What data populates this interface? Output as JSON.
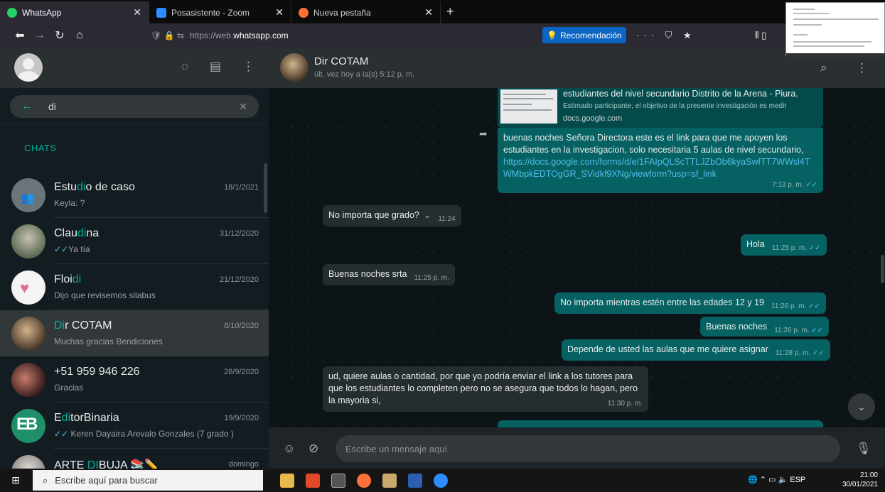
{
  "browser": {
    "tabs": [
      {
        "title": "WhatsApp",
        "active": true,
        "color": "#25d366"
      },
      {
        "title": "Posasistente - Zoom",
        "active": false,
        "color": "#2d8cff"
      },
      {
        "title": "Nueva pestaña",
        "active": false,
        "color": "#ff7139"
      }
    ],
    "url_prefix": "https://web.",
    "url_host": "whatsapp.com",
    "recommendation_label": "Recomendación"
  },
  "sidebar": {
    "search_value": "di",
    "chats_label": "CHATS",
    "chats": [
      {
        "pre": "Estu",
        "hl": "di",
        "post": "o de caso",
        "date": "18/1/2021",
        "preview": "Keyla: ?",
        "tick": false,
        "selected": false,
        "avatar": "group"
      },
      {
        "pre": "Clau",
        "hl": "di",
        "post": "na",
        "date": "31/12/2020",
        "preview": "Ya tía",
        "tick": true,
        "selected": false,
        "avatar": "photo1"
      },
      {
        "pre": "Floi",
        "hl": "di",
        "post": "",
        "date": "21/12/2020",
        "preview": "Dijo que revisemos silabus",
        "tick": false,
        "selected": false,
        "avatar": "photo2"
      },
      {
        "pre": "",
        "hl": "Di",
        "post": "r COTAM",
        "date": "8/10/2020",
        "preview": "Muchas gracias Bendiciones",
        "tick": false,
        "selected": true,
        "avatar": "photo3"
      },
      {
        "pre": "+51 959 946 226",
        "hl": "",
        "post": "",
        "date": "26/9/2020",
        "preview": "Gracias",
        "tick": false,
        "selected": false,
        "avatar": "photo4"
      },
      {
        "pre": "E",
        "hl": "di",
        "post": "torBinaria",
        "date": "19/9/2020",
        "preview": "Keren Dayaira Arevalo Gonzales (7 grado )",
        "tick": true,
        "selected": false,
        "avatar": "eb"
      },
      {
        "pre": "ARTE ",
        "hl": "DI",
        "post": "BUJA 📚✏️",
        "date": "domingo",
        "preview": "",
        "tick": false,
        "selected": false,
        "avatar": "photo5"
      }
    ]
  },
  "chat": {
    "contact_name": "Dir COTAM",
    "contact_status": "últ. vez hoy a la(s) 5:12 p. m.",
    "link_preview": {
      "title": "estudiantes del nivel secundario Distrito de la Arena - Piura.",
      "desc": "Estimado participante, el objetivo de la presente investigación es medir",
      "domain": "docs.google.com"
    },
    "messages": {
      "m1_text": "buenas noches Señora Directora este es el link para que me apoyen los estudiantes en la investigacion, solo necesitaria 5 aulas de nivel secundario,",
      "m1_link": "https://docs.google.com/forms/d/e/1FAIpQLScTTLJZbOb6kyaSwfTT7WWsl4TWMbpkEDTOgGR_SVidkf9XNg/viewform?usp=sf_link",
      "m1_time": "7:13 p. m.",
      "m2_text": "No importa que grado?",
      "m2_time": "11:24",
      "m3_text": "Hola",
      "m3_time": "11:25 p. m.",
      "m4_text": "Buenas noches srta",
      "m4_time": "11:25 p. m.",
      "m5_text": "No importa mientras estén entre las edades 12 y 19",
      "m5_time": "11:26 p. m.",
      "m6_text": "Buenas noches",
      "m6_time": "11:26 p. m.",
      "m7_text": "Depende de usted las aulas que me quiere asignar",
      "m7_time": "11:28 p. m.",
      "m8_text": "ud, quiere aulas o cantidad, por que yo podría enviar el link a los tutores para que los estudiantes lo completen pero no se asegura que todos lo hagan, pero la mayoria si,",
      "m8_time": "11:30 p. m."
    },
    "input_placeholder": "Escribe un mensaje aquí"
  },
  "taskbar": {
    "search_text": "Escribe aquí para buscar",
    "lang": "ESP",
    "time": "21:00",
    "date": "30/01/2021"
  }
}
